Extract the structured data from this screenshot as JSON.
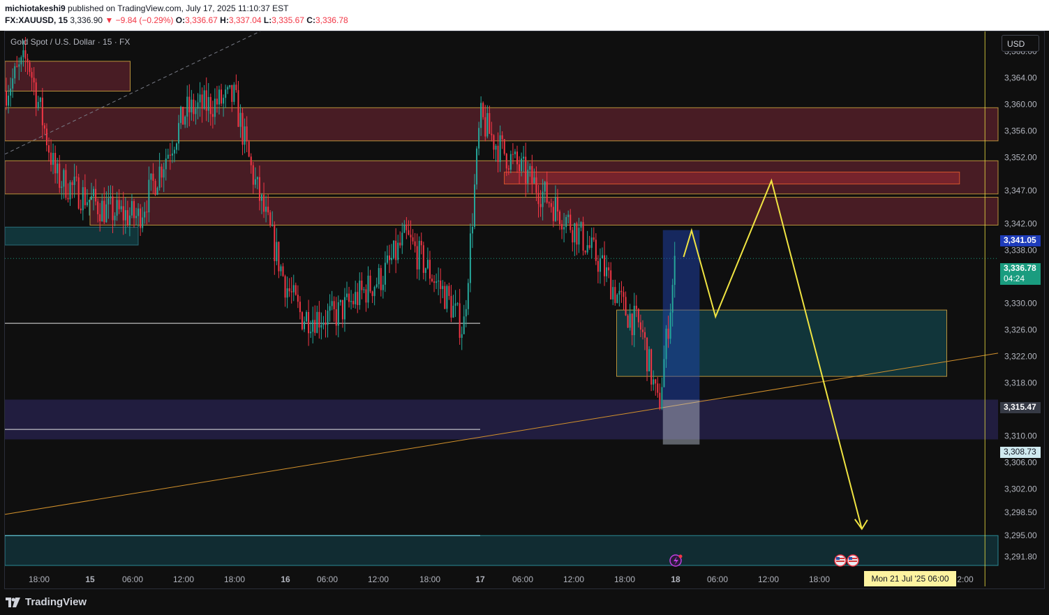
{
  "header": {
    "publisher": "michiotakeshi9",
    "published_text": "published on TradingView.com, July 17, 2025 11:10:37 EST",
    "symbol": "FX:XAUUSD, 15",
    "last_price": "3,336.90",
    "change": "−9.84 (−0.29%)",
    "open_label": "O:",
    "open": "3,336.67",
    "high_label": "H:",
    "high": "3,337.04",
    "low_label": "L:",
    "low": "3,335.67",
    "close_label": "C:",
    "close": "3,336.78"
  },
  "chart_title": "Gold Spot / U.S. Dollar · 15 · FX",
  "currency_button": "USD",
  "price_tags": {
    "upper": "3,341.05",
    "current": "3,336.78",
    "countdown": "04:24",
    "support": "3,315.47",
    "lower": "3,308.73"
  },
  "crosshair_date": "Mon 21 Jul '25   06:00",
  "footer": {
    "brand": "TradingView"
  },
  "colors": {
    "up": "#26a69a",
    "down": "#f23645",
    "projection": "#f0e442",
    "trendline": "#d4922c",
    "background": "#0f0f0f"
  },
  "chart_data": {
    "type": "candlestick",
    "symbol": "XAUUSD",
    "interval": "15",
    "y_ticks": [
      "3,368.00",
      "3,364.00",
      "3,360.00",
      "3,356.00",
      "3,352.00",
      "3,347.00",
      "3,342.00",
      "3,338.00",
      "3,334.00",
      "3,330.00",
      "3,326.00",
      "3,322.00",
      "3,318.00",
      "3,314.00",
      "3,310.00",
      "3,306.00",
      "3,302.00",
      "3,298.50",
      "3,295.00",
      "3,291.80"
    ],
    "x_ticks": [
      "18:00",
      "15",
      "06:00",
      "12:00",
      "18:00",
      "16",
      "06:00",
      "12:00",
      "18:00",
      "17",
      "06:00",
      "12:00",
      "18:00",
      "18",
      "06:00",
      "12:00",
      "18:00",
      "2:00"
    ],
    "ylim": [
      3290.5,
      3371.0
    ],
    "price_path": [
      {
        "t": "Jul 14 15:00",
        "p": 3362
      },
      {
        "t": "Jul 14 17:00",
        "p": 3367
      },
      {
        "t": "Jul 14 20:00",
        "p": 3349
      },
      {
        "t": "Jul 15 02:00",
        "p": 3344
      },
      {
        "t": "Jul 15 06:00",
        "p": 3343
      },
      {
        "t": "Jul 15 12:00",
        "p": 3359
      },
      {
        "t": "Jul 15 18:00",
        "p": 3361
      },
      {
        "t": "Jul 15 20:00",
        "p": 3350
      },
      {
        "t": "Jul 16 00:00",
        "p": 3333
      },
      {
        "t": "Jul 16 02:00",
        "p": 3328
      },
      {
        "t": "Jul 16 06:00",
        "p": 3328
      },
      {
        "t": "Jul 16 12:00",
        "p": 3334
      },
      {
        "t": "Jul 16 15:00",
        "p": 3340
      },
      {
        "t": "Jul 16 20:00",
        "p": 3331
      },
      {
        "t": "Jul 16 22:00",
        "p": 3326
      },
      {
        "t": "Jul 17 00:00",
        "p": 3358
      },
      {
        "t": "Jul 17 02:00",
        "p": 3354
      },
      {
        "t": "Jul 17 06:00",
        "p": 3349
      },
      {
        "t": "Jul 17 12:00",
        "p": 3341
      },
      {
        "t": "Jul 17 15:00",
        "p": 3336
      },
      {
        "t": "Jul 17 18:00",
        "p": 3329
      },
      {
        "t": "Jul 17 20:00",
        "p": 3326
      },
      {
        "t": "Jul 17 22:00",
        "p": 3314
      },
      {
        "t": "Jul 18 00:00",
        "p": 3336.78
      }
    ],
    "zones": [
      {
        "kind": "supply",
        "from": "Jul 14 15:00",
        "to": "Jul 15 05:00",
        "top": 3366.5,
        "bottom": 3362
      },
      {
        "kind": "supply",
        "from": "Jul 14 15:00",
        "to": "right-edge",
        "top": 3359.5,
        "bottom": 3354.5
      },
      {
        "kind": "supply",
        "from": "Jul 14 15:00",
        "to": "right-edge",
        "top": 3351.5,
        "bottom": 3346.5
      },
      {
        "kind": "supply",
        "from": "Jul 15 00:00",
        "to": "right-edge",
        "top": 3346,
        "bottom": 3341.8
      },
      {
        "kind": "supply",
        "from": "Jul 17 03:00",
        "to": "Jul 20 18:00",
        "top": 3349.8,
        "bottom": 3348
      },
      {
        "kind": "demand",
        "from": "Jul 14 15:00",
        "to": "Jul 15 06:00",
        "top": 3341.5,
        "bottom": 3338.8
      },
      {
        "kind": "demand",
        "from": "Jul 17 17:00",
        "to": "Jul 20 12:00",
        "top": 3329,
        "bottom": 3319
      },
      {
        "kind": "range",
        "from": "Jul 14 15:00",
        "to": "right-edge",
        "top": 3315.5,
        "bottom": 3309.5
      },
      {
        "kind": "demand",
        "from": "Jul 14 15:00",
        "to": "right-edge",
        "top": 3295,
        "bottom": 3290.5
      }
    ],
    "horizontal_lines": [
      {
        "price": 3327,
        "from": "Jul 14 15:00",
        "to": "Jul 17 00:00"
      },
      {
        "price": 3311,
        "from": "Jul 14 15:00",
        "to": "Jul 17 00:00"
      },
      {
        "price": 3295,
        "from": "Jul 14 15:00",
        "to": "Jul 17 00:00"
      }
    ],
    "trendline": {
      "from": [
        "Jul 14 15:00",
        3298.2
      ],
      "to": [
        "right-edge",
        3322.5
      ]
    },
    "dashed_trendline": {
      "from": [
        "Jul 14 15:00",
        3352.5
      ],
      "to": [
        "Jul 15 21:00",
        3371
      ]
    },
    "long_position": {
      "from": "Jul 17 22:30",
      "to": "Jul 18 03:00",
      "target": 3341.05,
      "entry": 3315.47,
      "stop": 3308.73
    },
    "projection": [
      {
        "t": "Jul 18 01:00",
        "p": 3337
      },
      {
        "t": "Jul 18 02:00",
        "p": 3341
      },
      {
        "t": "Jul 18 05:00",
        "p": 3328
      },
      {
        "t": "Jul 18 12:00",
        "p": 3348.5
      },
      {
        "t": "Jul 18 23:00",
        "p": 3296
      }
    ],
    "crosshair": {
      "t": "Jul 21 06:00"
    },
    "grid": false,
    "legend": "none"
  }
}
